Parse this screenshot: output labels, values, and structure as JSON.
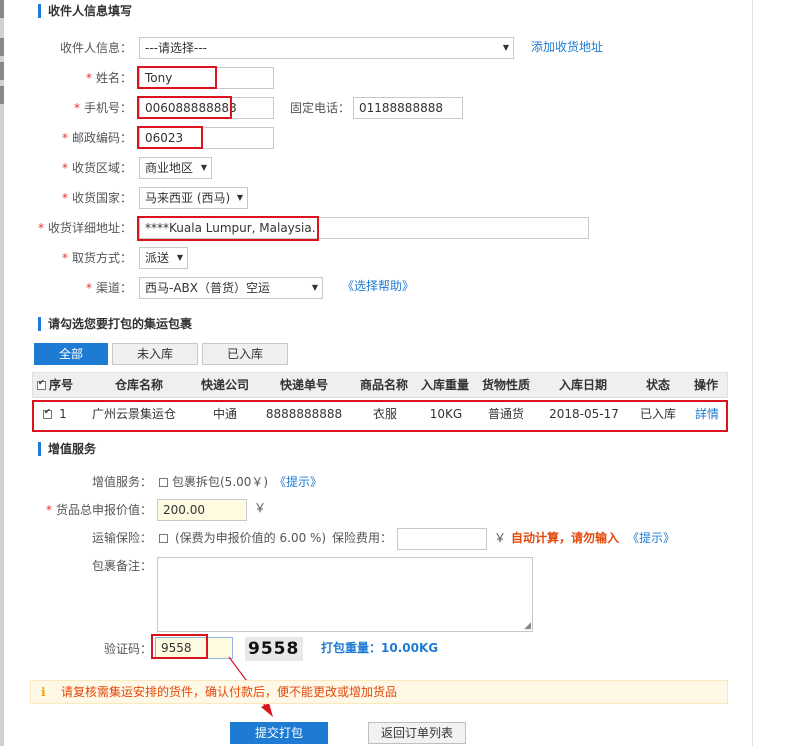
{
  "recipient_section": {
    "title": "收件人信息填写",
    "recipient_info_label": "收件人信息：",
    "recipient_info_value": "---请选择---",
    "add_address_link": "添加收货地址",
    "name_label": "姓名：",
    "name_value": "Tony",
    "mobile_label": "手机号：",
    "mobile_value": "006088888888",
    "phone_label": "固定电话：",
    "phone_value": "01188888888",
    "postcode_label": "邮政编码：",
    "postcode_value": "06023",
    "region_label": "收货区域：",
    "region_value": "商业地区",
    "country_label": "收货国家：",
    "country_value": "马来西亚 (西马)",
    "address_label": "收货详细地址：",
    "address_value": "****Kuala Lumpur, Malaysia.",
    "pickup_label": "取货方式：",
    "pickup_value": "派送",
    "channel_label": "渠道：",
    "channel_value": "西马-ABX（普货）空运",
    "channel_help_link": "《选择帮助》",
    "required_mark": "*"
  },
  "parcel_section": {
    "title": "请勾选您要打包的集运包裹",
    "tabs": [
      "全部",
      "未入库",
      "已入库"
    ],
    "columns": [
      "序号",
      "仓库名称",
      "快递公司",
      "快递单号",
      "商品名称",
      "入库重量",
      "货物性质",
      "入库日期",
      "状态",
      "操作"
    ],
    "rows": [
      {
        "index": "1",
        "warehouse": "广州云景集运仓",
        "courier": "中通",
        "tracking": "8888888888",
        "goods": "衣服",
        "weight": "10KG",
        "nature": "普通货",
        "date": "2018-05-17",
        "status": "已入库",
        "action": "詳情"
      }
    ]
  },
  "value_section": {
    "title": "增值服务",
    "service_label": "增值服务：",
    "split_option": "包裹拆包(5.00￥)",
    "tip_link": "《提示》",
    "declared_label": "货品总申报价值：",
    "declared_value": "200.00",
    "currency": "￥",
    "insurance_label": "运输保险：",
    "insurance_option": "(保费为申报价值的 6.00 %)",
    "insurance_fee_label": "保险费用：",
    "auto_calc_text": "自动计算，请勿输入",
    "remark_label": "包裹备注：",
    "captcha_label": "验证码：",
    "captcha_value": "9558",
    "captcha_image_text": "9558",
    "pack_weight_text": "打包重量：10.00KG"
  },
  "notice": {
    "icon": "info-icon",
    "text": "请复核需集运安排的货件，确认付款后，便不能更改或增加货品"
  },
  "actions": {
    "submit_label": "提交打包",
    "back_label": "返回订单列表"
  },
  "colors": {
    "accent": "#1e7bd3",
    "highlight_red": "#d9141f",
    "warning_text": "#e34a0c"
  }
}
